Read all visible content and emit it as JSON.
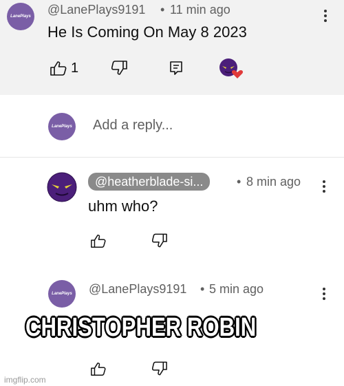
{
  "thread": {
    "parent": {
      "avatar_text": "LanePlays",
      "handle": "@LanePlays9191",
      "separator": "•",
      "time": "11 min ago",
      "text": "He Is Coming On May 8 2023",
      "like_count": "1",
      "icons": [
        "thumbs-up-icon",
        "thumbs-down-icon",
        "reply-icon",
        "creator-heart-icon",
        "more-vert-icon"
      ]
    },
    "reply_box": {
      "avatar_text": "LanePlays",
      "placeholder": "Add a reply..."
    },
    "replies": [
      {
        "handle": "@heatherblade-si...",
        "separator": "•",
        "time": "8 min ago",
        "text": "uhm who?"
      },
      {
        "avatar_text": "LanePlays",
        "handle": "@LanePlays9191",
        "separator": "•",
        "time": "5 min ago"
      }
    ]
  },
  "meme": {
    "caption": "CHRISTOPHER ROBIN",
    "watermark": "imgflip.com"
  },
  "colors": {
    "avatar_purple": "#7a5ea6",
    "heart_red": "#e03a3a",
    "chip_gray": "#8a8a8a"
  }
}
